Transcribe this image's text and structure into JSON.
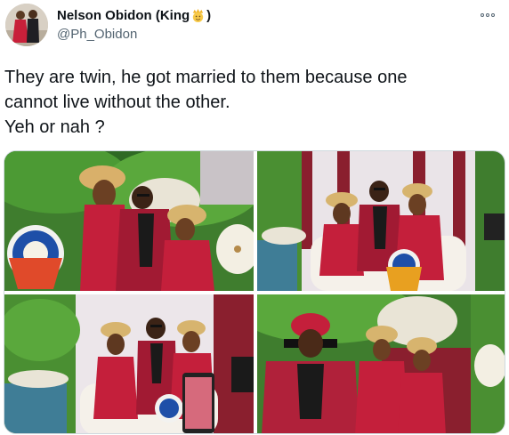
{
  "author": {
    "display_name": "Nelson Obidon (King",
    "name_emoji": "crown-face",
    "name_close": ")",
    "handle": "@Ph_Obidon"
  },
  "more_icon": "more-horizontal-icon",
  "tweet": {
    "lines": [
      "They are twin, he got married to them because one",
      "cannot live without the other.",
      "Yeh or nah ?"
    ]
  },
  "media": {
    "count": 4,
    "photos": [
      {
        "subject": "groom with two brides, decorative fans, green backdrop"
      },
      {
        "subject": "groom seated on white sofa between two brides"
      },
      {
        "subject": "groom and brides seated, guest holding phone"
      },
      {
        "subject": "groom in red cap standing beside two brides"
      }
    ]
  },
  "colors": {
    "text": "#0f1419",
    "secondary": "#536471",
    "border": "#cfd9de",
    "attire_red": "#b0213a"
  }
}
